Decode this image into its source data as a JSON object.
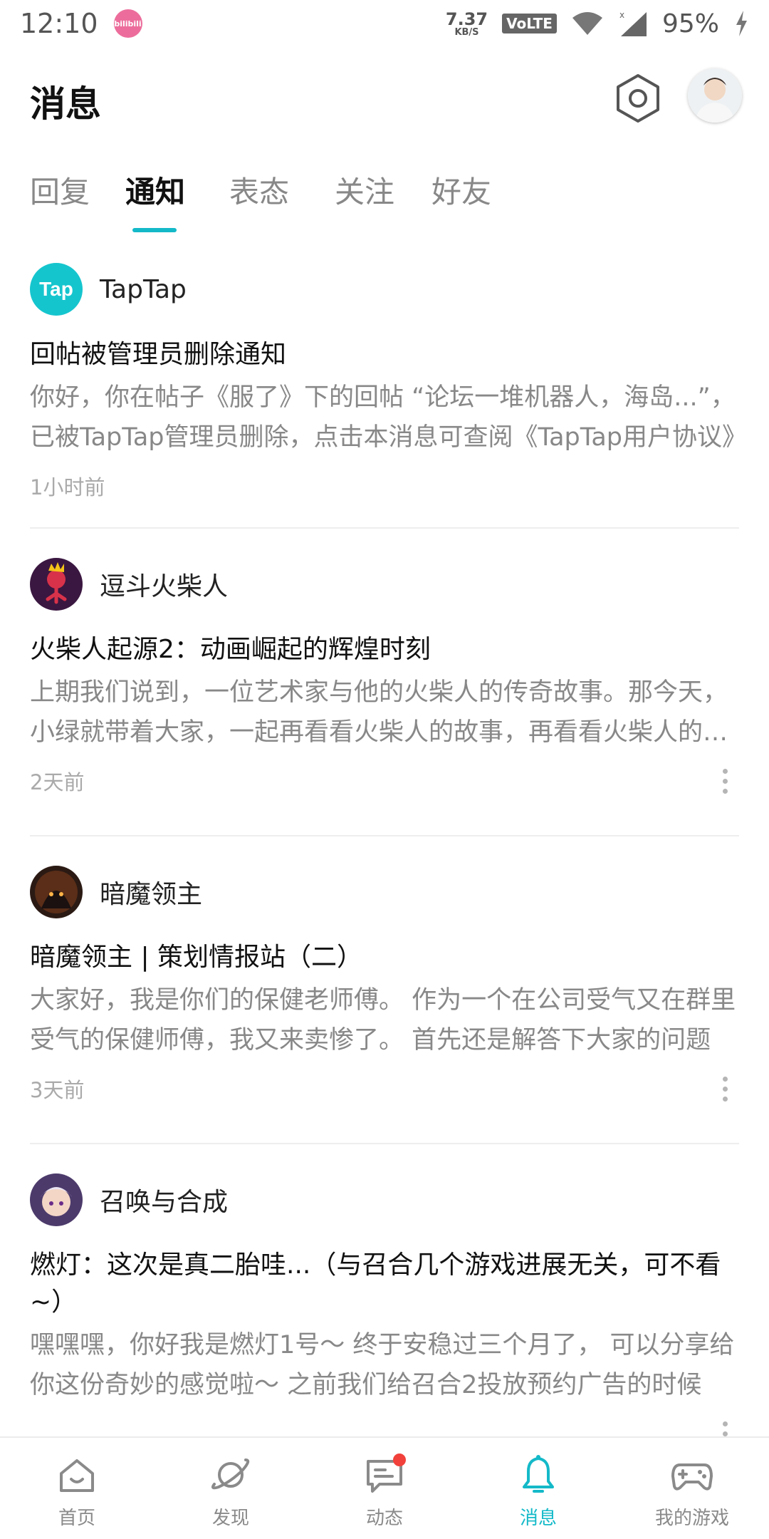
{
  "status_bar": {
    "time": "12:10",
    "app_badge": "bilibili",
    "net_speed": "7.37",
    "net_speed_unit": "KB/S",
    "volte": "VoLTE",
    "battery": "95%"
  },
  "header": {
    "title": "消息"
  },
  "tabs": [
    {
      "label": "回复",
      "active": false
    },
    {
      "label": "通知",
      "active": true
    },
    {
      "label": "表态",
      "active": false
    },
    {
      "label": "关注",
      "active": false
    },
    {
      "label": "好友",
      "active": false
    }
  ],
  "notifications": [
    {
      "author": "TapTap",
      "avatar_text": "Tap",
      "title": "回帖被管理员删除通知",
      "body": "你好，你在帖子《服了》下的回帖 “论坛一堆机器人，海岛...”，已被TapTap管理员删除，点击本消息可查阅《TapTap用户协议》",
      "time": "1小时前",
      "has_more": false
    },
    {
      "author": "逗斗火柴人",
      "title": "火柴人起源2：动画崛起的辉煌时刻",
      "body": "上期我们说到，一位艺术家与他的火柴人的传奇故事。那今天，小绿就带着大家，一起再看看火柴人的故事，再看看火柴人的发展",
      "time": "2天前",
      "has_more": true
    },
    {
      "author": "暗魔领主",
      "title": "暗魔领主 | 策划情报站（二）",
      "body": "大家好，我是你们的保健老师傅。 作为一个在公司受气又在群里受气的保健师傅，我又来卖惨了。 首先还是解答下大家的问题",
      "time": "3天前",
      "has_more": true
    },
    {
      "author": "召唤与合成",
      "title": "燃灯：这次是真二胎哇...（与召合几个游戏进展无关，可不看~）",
      "body": "嘿嘿嘿，你好我是燃灯1号～ 终于安稳过三个月了， 可以分享给你这份奇妙的感觉啦～ 之前我们给召合2投放预约广告的时候",
      "time": "",
      "has_more": true
    }
  ],
  "bottom_nav": [
    {
      "label": "首页",
      "icon": "home-icon",
      "active": false
    },
    {
      "label": "发现",
      "icon": "discover-planet-icon",
      "active": false
    },
    {
      "label": "动态",
      "icon": "feed-chat-icon",
      "active": false,
      "badge": true
    },
    {
      "label": "消息",
      "icon": "bell-icon",
      "active": true
    },
    {
      "label": "我的游戏",
      "icon": "gamepad-icon",
      "active": false
    }
  ],
  "colors": {
    "accent": "#14b9c8",
    "badge_red": "#f1413a",
    "text_secondary": "#888888"
  }
}
